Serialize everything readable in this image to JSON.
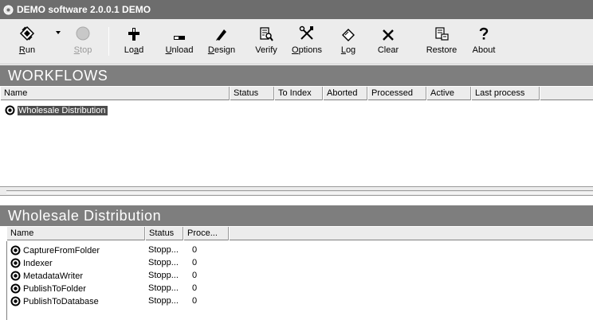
{
  "window": {
    "title": "DEMO software 2.0.0.1 DEMO"
  },
  "toolbar": {
    "buttons": [
      {
        "label": "Run",
        "mnemonic": "R",
        "rest": "un",
        "icon": "run-icon"
      },
      {
        "label": "Stop",
        "mnemonic": "S",
        "rest": "top",
        "icon": "stop-icon",
        "disabled": true
      },
      {
        "label": "Load",
        "pre": "Lo",
        "mnemonic": "a",
        "rest": "d",
        "icon": "load-icon"
      },
      {
        "label": "Unload",
        "mnemonic": "U",
        "rest": "nload",
        "icon": "unload-icon"
      },
      {
        "label": "Design",
        "mnemonic": "D",
        "rest": "esign",
        "icon": "design-icon"
      },
      {
        "label": "Verify",
        "icon": "verify-icon"
      },
      {
        "label": "Options",
        "mnemonic": "O",
        "rest": "ptions",
        "icon": "options-icon"
      },
      {
        "label": "Log",
        "mnemonic": "L",
        "rest": "og",
        "icon": "log-icon"
      },
      {
        "label": "Clear",
        "icon": "clear-icon"
      },
      {
        "label": "Restore",
        "icon": "restore-icon"
      },
      {
        "label": "About",
        "icon": "about-icon"
      }
    ]
  },
  "workflows": {
    "heading": "WORKFLOWS",
    "columns": [
      "Name",
      "Status",
      "To Index",
      "Aborted",
      "Processed",
      "Active",
      "Last process"
    ],
    "rows": [
      {
        "name": "Wholesale Distribution",
        "selected": true
      }
    ]
  },
  "details": {
    "heading": "Wholesale Distribution",
    "columns": [
      "Name",
      "Status",
      "Proce..."
    ],
    "rows": [
      {
        "name": "CaptureFromFolder",
        "status": "Stopp...",
        "processed": "0"
      },
      {
        "name": "Indexer",
        "status": "Stopp...",
        "processed": "0"
      },
      {
        "name": "MetadataWriter",
        "status": "Stopp...",
        "processed": "0"
      },
      {
        "name": "PublishToFolder",
        "status": "Stopp...",
        "processed": "0"
      },
      {
        "name": "PublishToDatabase",
        "status": "Stopp...",
        "processed": "0"
      }
    ]
  },
  "colors": {
    "title_bar": "#6d6d6d",
    "band": "#7e7e7e",
    "selection": "#4d4d4d",
    "toolbar": "#ececec"
  }
}
